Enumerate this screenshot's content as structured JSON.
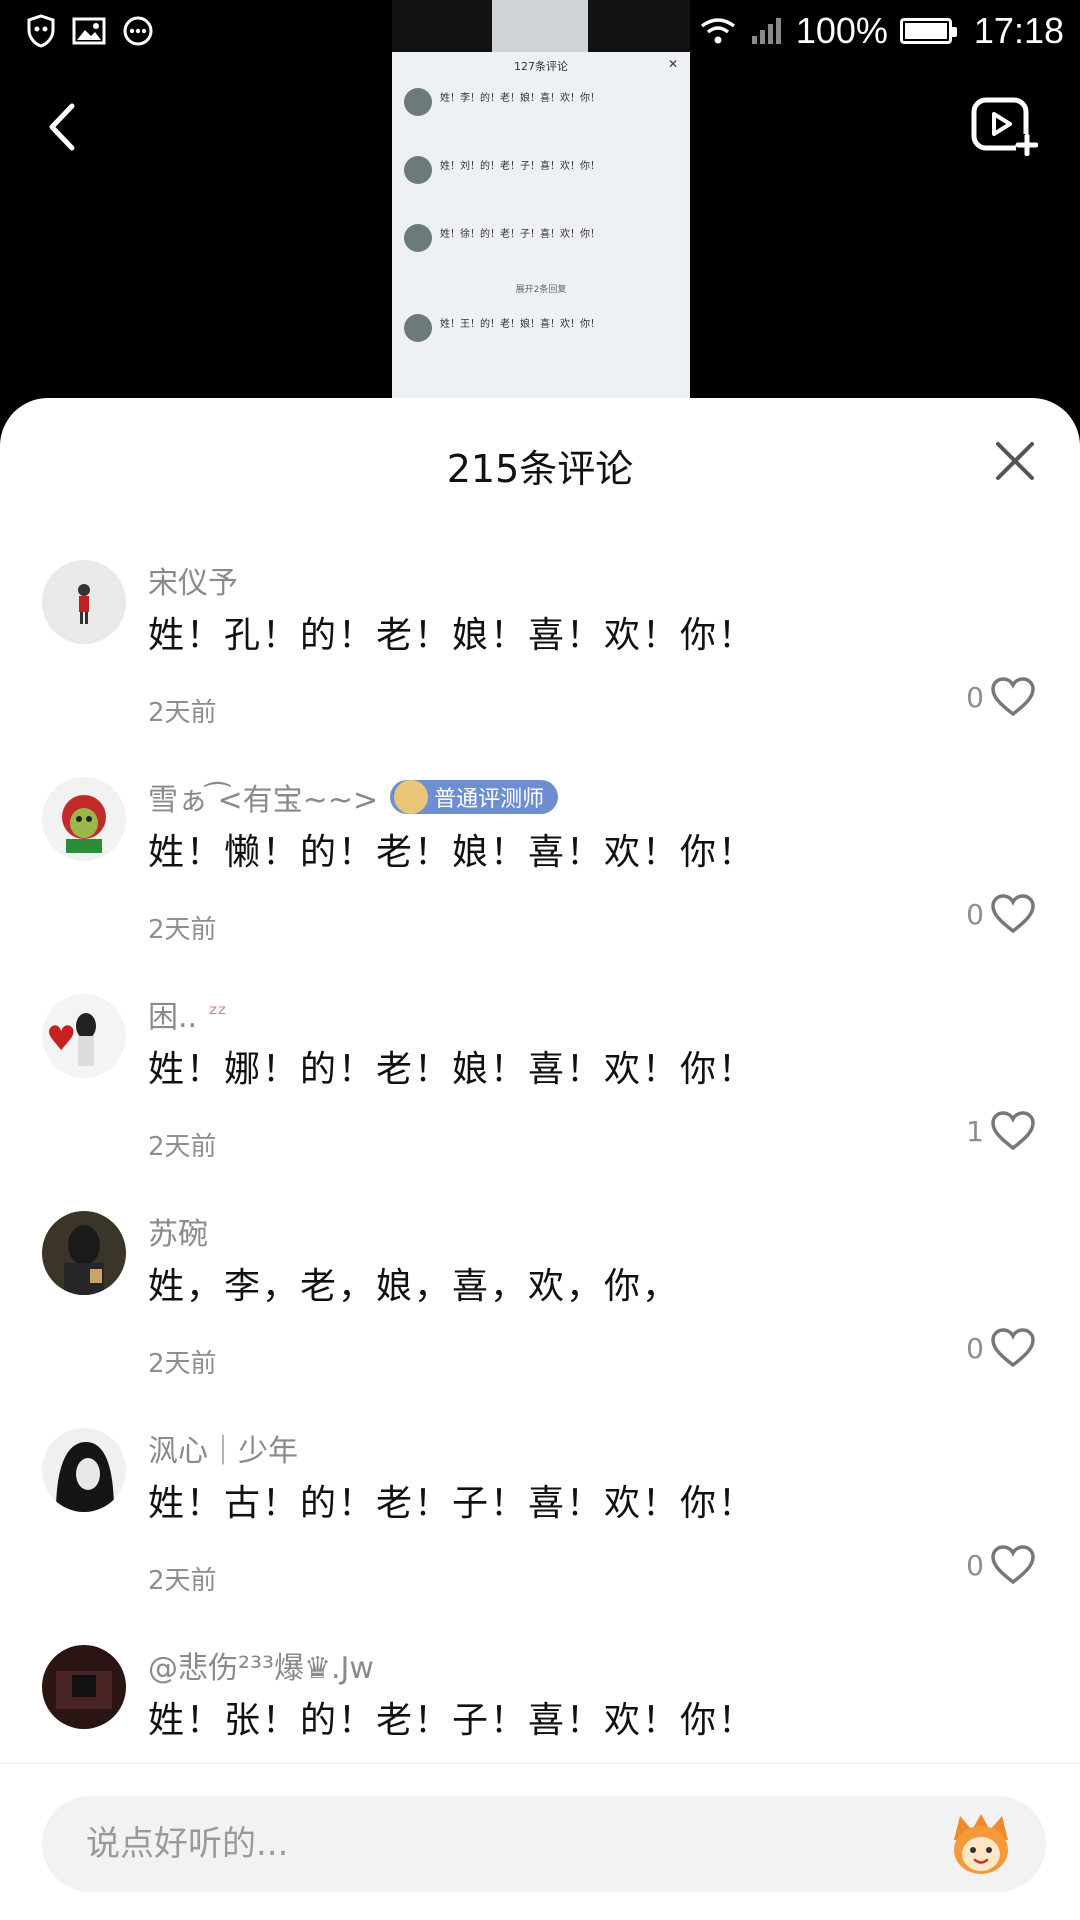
{
  "status_bar": {
    "battery_percent": "100%",
    "time": "17:18"
  },
  "embedded_screenshot": {
    "title": "127条评论",
    "comments": [
      {
        "text": "姓！李！的！老！娘！喜！欢！你！"
      },
      {
        "text": "姓！刘！的！老！子！喜！欢！你！"
      },
      {
        "text": "姓！徐！的！老！子！喜！欢！你！"
      },
      {
        "text": "姓！王！的！老！娘！喜！欢！你！"
      }
    ],
    "expand_text": "展开2条回复"
  },
  "sheet": {
    "title": "215条评论"
  },
  "comments": [
    {
      "username": "宋仪予",
      "text": "姓！孔！的！老！娘！喜！欢！你！",
      "time": "2天前",
      "likes": "0"
    },
    {
      "username": "雪ぁ ͡<有宝~~>",
      "badge": "普通评测师",
      "text": "姓！懒！的！老！娘！喜！欢！你！",
      "time": "2天前",
      "likes": "0"
    },
    {
      "username": "困..",
      "text": "姓！娜！的！老！娘！喜！欢！你！",
      "time": "2天前",
      "likes": "1"
    },
    {
      "username": "苏碗",
      "text": "姓，李，老，娘，喜，欢，你，",
      "time": "2天前",
      "likes": "0"
    },
    {
      "username": "沨心｜少年",
      "text": "姓！古！的！老！子！喜！欢！你！",
      "time": "2天前",
      "likes": "0"
    },
    {
      "username": "@悲伤²³³爆♛.Jw",
      "text": "姓！张！的！老！子！喜！欢！你！",
      "time": "",
      "likes": ""
    }
  ],
  "input": {
    "placeholder": "说点好听的..."
  },
  "colors": {
    "badge": "#6d8fd1",
    "muted_text": "#8e8e8e",
    "input_bg": "#f2f2f2"
  }
}
